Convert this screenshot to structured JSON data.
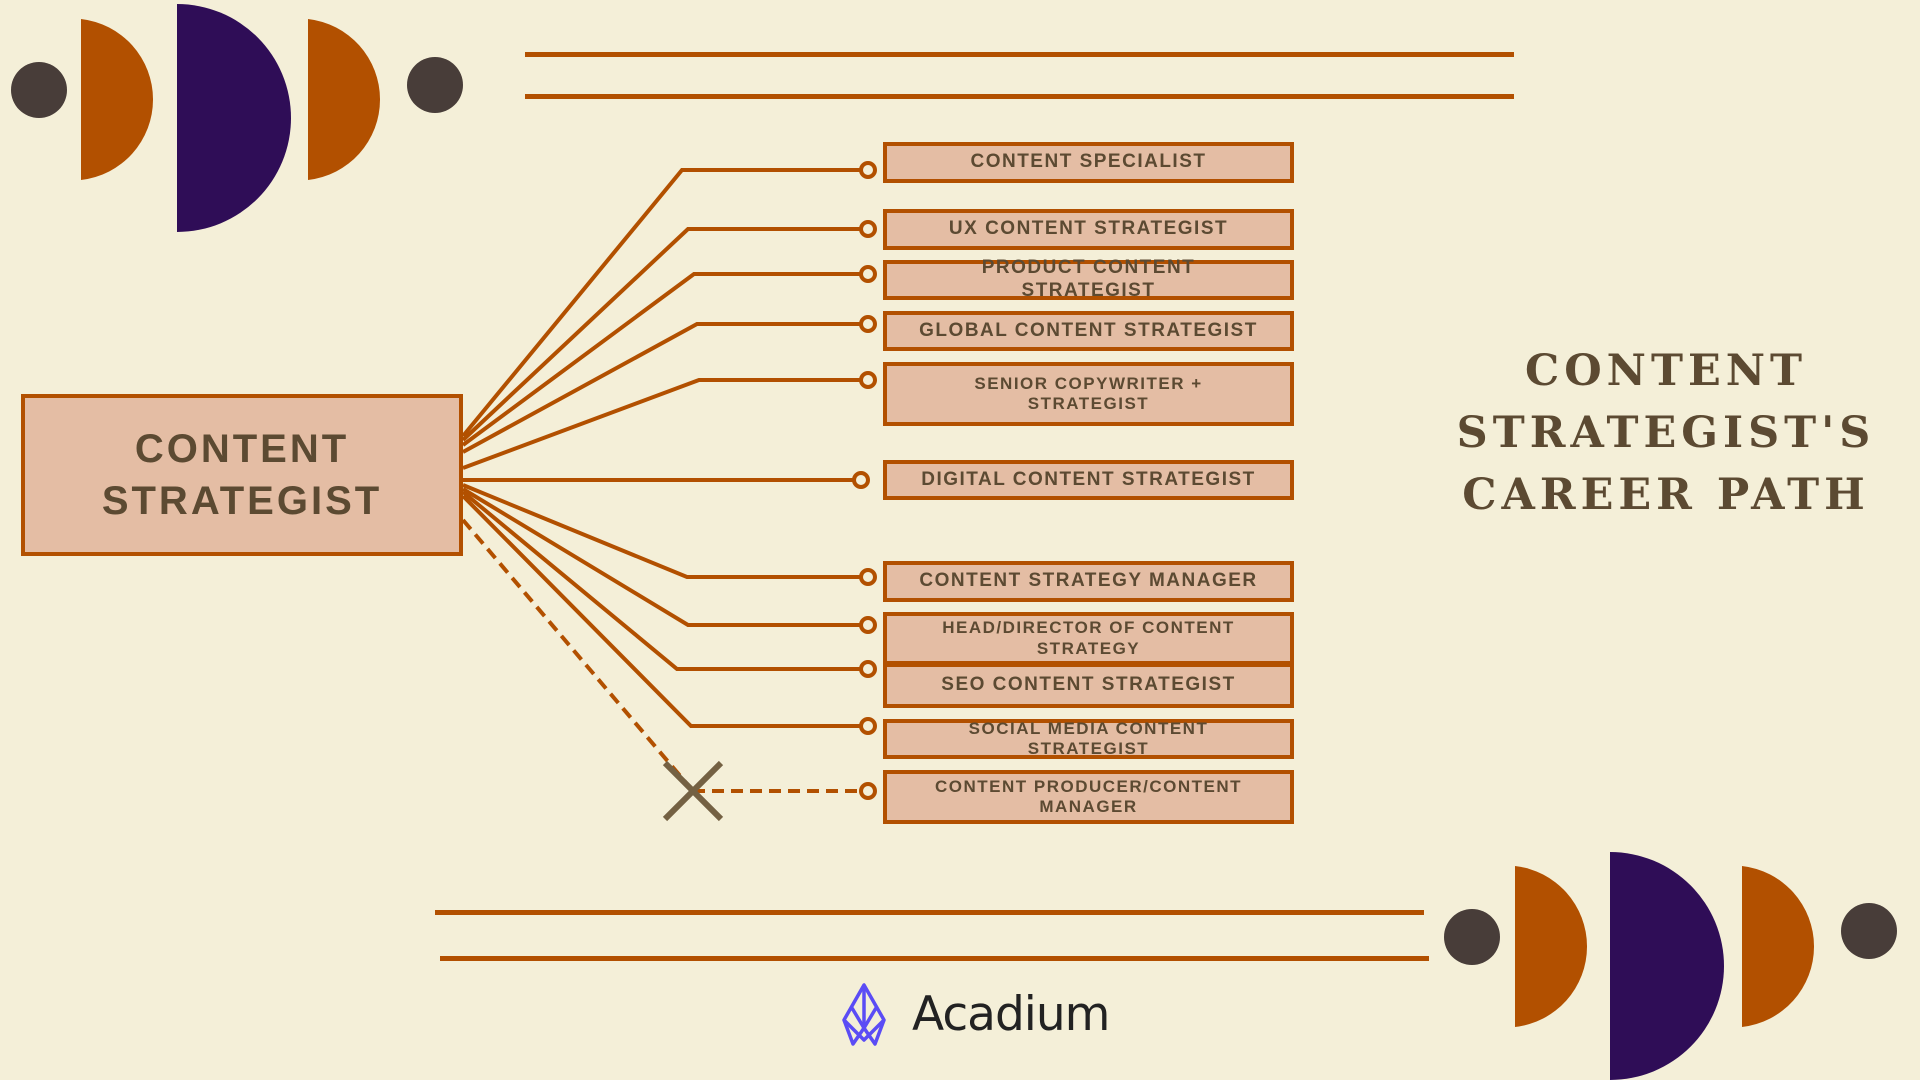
{
  "title": {
    "lines": [
      "CONTENT",
      "STRATEGIST'S",
      "CAREER PATH"
    ]
  },
  "root_role": {
    "line1": "CONTENT",
    "line2": "STRATEGIST"
  },
  "career_paths": [
    {
      "label": "CONTENT SPECIALIST",
      "connector": "solid"
    },
    {
      "label": "UX CONTENT STRATEGIST",
      "connector": "solid"
    },
    {
      "label": "PRODUCT CONTENT STRATEGIST",
      "connector": "solid"
    },
    {
      "label": "GLOBAL CONTENT STRATEGIST",
      "connector": "solid"
    },
    {
      "label": "SENIOR COPYWRITER + STRATEGIST",
      "connector": "solid"
    },
    {
      "label": "DIGITAL CONTENT STRATEGIST",
      "connector": "solid"
    },
    {
      "label": "CONTENT STRATEGY MANAGER",
      "connector": "solid"
    },
    {
      "label": "HEAD/DIRECTOR OF CONTENT STRATEGY",
      "connector": "solid"
    },
    {
      "label": "SEO CONTENT STRATEGIST",
      "connector": "solid"
    },
    {
      "label": "SOCIAL MEDIA CONTENT STRATEGIST",
      "connector": "solid"
    },
    {
      "label": "CONTENT PRODUCER/CONTENT MANAGER",
      "connector": "dashed-crossed"
    }
  ],
  "brand": {
    "name": "Acadium",
    "icon": "acadium-logo-icon"
  },
  "colors": {
    "background": "#f4efd8",
    "accent_orange": "#b25000",
    "accent_purple": "#2f0d57",
    "dot": "#483d39",
    "box_fill": "#e4bda4",
    "text": "#5c4a32",
    "cross": "#746143",
    "brand_blue": "#5b4cf5"
  }
}
